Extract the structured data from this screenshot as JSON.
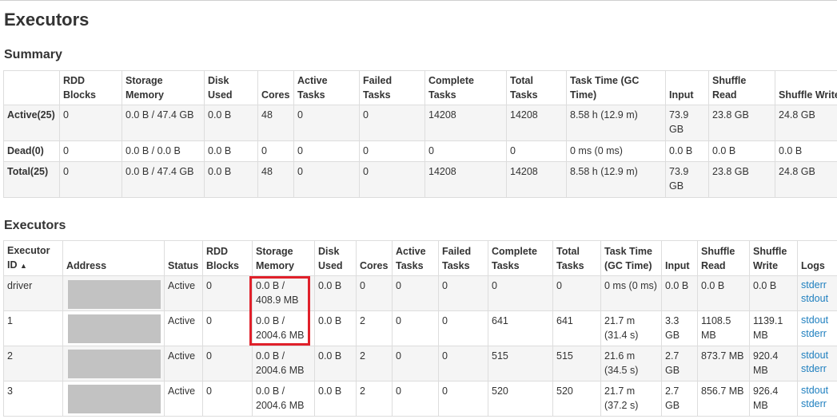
{
  "page": {
    "title": "Executors"
  },
  "summary": {
    "title": "Summary",
    "headers": [
      "",
      "RDD Blocks",
      "Storage Memory",
      "Disk Used",
      "Cores",
      "Active Tasks",
      "Failed Tasks",
      "Complete Tasks",
      "Total Tasks",
      "Task Time (GC Time)",
      "Input",
      "Shuffle Read",
      "Shuffle Write"
    ],
    "rows": [
      [
        "Active(25)",
        "0",
        "0.0 B / 47.4 GB",
        "0.0 B",
        "48",
        "0",
        "0",
        "14208",
        "14208",
        "8.58 h (12.9 m)",
        "73.9 GB",
        "23.8 GB",
        "24.8 GB"
      ],
      [
        "Dead(0)",
        "0",
        "0.0 B / 0.0 B",
        "0.0 B",
        "0",
        "0",
        "0",
        "0",
        "0",
        "0 ms (0 ms)",
        "0.0 B",
        "0.0 B",
        "0.0 B"
      ],
      [
        "Total(25)",
        "0",
        "0.0 B / 47.4 GB",
        "0.0 B",
        "48",
        "0",
        "0",
        "14208",
        "14208",
        "8.58 h (12.9 m)",
        "73.9 GB",
        "23.8 GB",
        "24.8 GB"
      ]
    ]
  },
  "executors": {
    "title": "Executors",
    "headers": [
      "Executor ID",
      "Address",
      "Status",
      "RDD Blocks",
      "Storage Memory",
      "Disk Used",
      "Cores",
      "Active Tasks",
      "Failed Tasks",
      "Complete Tasks",
      "Total Tasks",
      "Task Time (GC Time)",
      "Input",
      "Shuffle Read",
      "Shuffle Write",
      "Logs"
    ],
    "sort_indicator": "▲",
    "rows": [
      [
        "driver",
        "",
        "Active",
        "0",
        "0.0 B / 408.9 MB",
        "0.0 B",
        "0",
        "0",
        "0",
        "0",
        "0",
        "0 ms (0 ms)",
        "0.0 B",
        "0.0 B",
        "0.0 B"
      ],
      [
        "1",
        "",
        "Active",
        "0",
        "0.0 B / 2004.6 MB",
        "0.0 B",
        "2",
        "0",
        "0",
        "641",
        "641",
        "21.7 m (31.4 s)",
        "3.3 GB",
        "1108.5 MB",
        "1139.1 MB"
      ],
      [
        "2",
        "",
        "Active",
        "0",
        "0.0 B / 2004.6 MB",
        "0.0 B",
        "2",
        "0",
        "0",
        "515",
        "515",
        "21.6 m (34.5 s)",
        "2.7 GB",
        "873.7 MB",
        "920.4 MB"
      ],
      [
        "3",
        "",
        "Active",
        "0",
        "0.0 B / 2004.6 MB",
        "0.0 B",
        "2",
        "0",
        "0",
        "520",
        "520",
        "21.7 m (37.2 s)",
        "2.7 GB",
        "856.7 MB",
        "926.4 MB"
      ]
    ],
    "log_links": {
      "stderr": "stderr",
      "stdout": "stdout"
    }
  },
  "colors": {
    "highlight": "#e0202a",
    "link": "#1e7fbf",
    "stripe": "#f5f5f5",
    "border": "#dddddd"
  }
}
